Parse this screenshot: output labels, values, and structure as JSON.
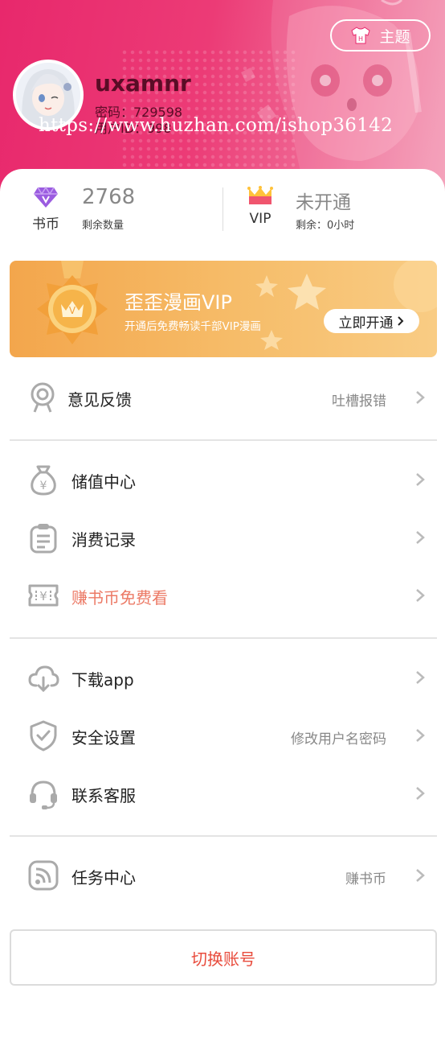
{
  "header": {
    "theme_label": "主题",
    "username": "uxamnr",
    "password_line": "密码：729598",
    "userid_line": "用户ID：998",
    "watermark": "https://www.huzhan.com/ishop36142"
  },
  "stats": {
    "coins": {
      "label": "书币",
      "value": "2768",
      "sub": "剩余数量"
    },
    "vip": {
      "label": "VIP",
      "value": "未开通",
      "sub": "剩余：0小时"
    }
  },
  "vip_banner": {
    "title": "歪歪漫画VIP",
    "desc": "开通后免费畅读千部VIP漫画",
    "button": "立即开通"
  },
  "menu": {
    "feedback": {
      "label": "意见反馈",
      "hint": "吐槽报错",
      "icon": "feedback-icon"
    },
    "recharge": {
      "label": "储值中心",
      "icon": "money-bag-icon"
    },
    "records": {
      "label": "消费记录",
      "icon": "clipboard-icon"
    },
    "earn": {
      "label": "赚书币免费看",
      "icon": "ticket-icon"
    },
    "download": {
      "label": "下载app",
      "icon": "cloud-download-icon"
    },
    "security": {
      "label": "安全设置",
      "hint": "修改用户名密码",
      "icon": "shield-icon"
    },
    "service": {
      "label": "联系客服",
      "icon": "headset-icon"
    },
    "tasks": {
      "label": "任务中心",
      "hint": "赚书币",
      "icon": "rss-icon"
    }
  },
  "switch_account": "切换账号",
  "colors": {
    "header_pink": "#e8286c",
    "vip_orange": "#f3a64c",
    "accent_red": "#e84b3c",
    "earn_text": "#ec7a66"
  }
}
